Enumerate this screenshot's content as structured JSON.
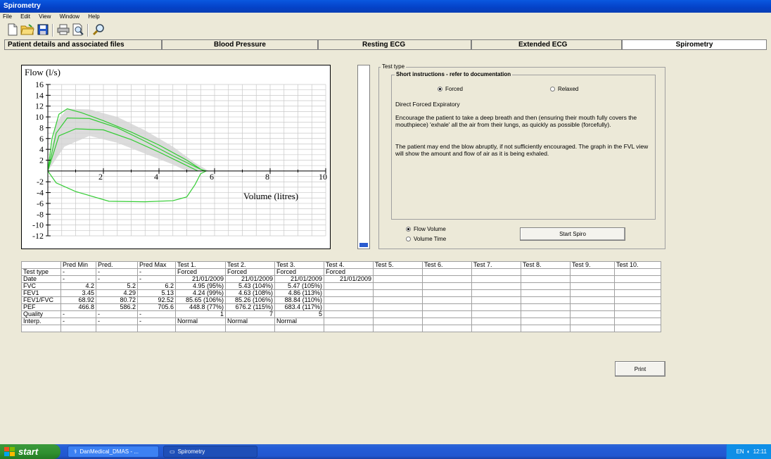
{
  "window": {
    "title": "Spirometry"
  },
  "menu": {
    "items": [
      "File",
      "Edit",
      "View",
      "Window",
      "Help"
    ]
  },
  "toolbar": {
    "icons": [
      "new-file-icon",
      "open-folder-icon",
      "save-icon",
      "print-icon",
      "print-preview-icon",
      "find-icon"
    ]
  },
  "tabs": [
    {
      "label": "Patient details and associated files",
      "active": false
    },
    {
      "label": "Blood Pressure",
      "active": false
    },
    {
      "label": "Resting ECG",
      "active": false
    },
    {
      "label": "Extended ECG",
      "active": false
    },
    {
      "label": "Spirometry",
      "active": true
    }
  ],
  "chart_data": {
    "type": "line",
    "ylabel": "Flow (l/s)",
    "xlabel": "Volume (litres)",
    "xlim": [
      0,
      10
    ],
    "ylim": [
      -12,
      16
    ],
    "xticks": [
      2,
      4,
      6,
      8,
      10
    ],
    "yticks": [
      16,
      14,
      12,
      10,
      8,
      6,
      4,
      2,
      -2,
      -4,
      -6,
      -8,
      -10,
      -12
    ],
    "grid": true,
    "colors": {
      "curves": "#33cc33",
      "band": "#d3d3d3"
    },
    "predicted_band": {
      "upper": [
        [
          0,
          0
        ],
        [
          0.3,
          9
        ],
        [
          0.7,
          11.5
        ],
        [
          1.5,
          11.4
        ],
        [
          2.5,
          10
        ],
        [
          3.5,
          7.5
        ],
        [
          4.5,
          4.5
        ],
        [
          5.3,
          1.5
        ],
        [
          5.8,
          0
        ]
      ],
      "lower": [
        [
          0,
          0
        ],
        [
          0.6,
          4.5
        ],
        [
          1.5,
          6.5
        ],
        [
          2.5,
          5.2
        ],
        [
          3.5,
          3.2
        ],
        [
          4.5,
          1.2
        ],
        [
          5.0,
          0
        ]
      ]
    },
    "series": [
      {
        "points": [
          [
            0,
            0
          ],
          [
            0.15,
            6
          ],
          [
            0.4,
            10.5
          ],
          [
            0.7,
            11.5
          ],
          [
            1.2,
            10.8
          ],
          [
            2,
            9.3
          ],
          [
            3,
            7.2
          ],
          [
            4,
            4.8
          ],
          [
            5,
            2
          ],
          [
            5.6,
            0
          ]
        ]
      },
      {
        "points": [
          [
            0,
            0
          ],
          [
            0.3,
            7
          ],
          [
            0.7,
            9.8
          ],
          [
            1.5,
            9.7
          ],
          [
            2.5,
            8
          ],
          [
            3.5,
            5.5
          ],
          [
            4.5,
            2.8
          ],
          [
            5.5,
            0.3
          ],
          [
            5.7,
            0
          ]
        ]
      },
      {
        "points": [
          [
            0,
            0
          ],
          [
            0.4,
            6.5
          ],
          [
            1,
            7.8
          ],
          [
            2,
            7.6
          ],
          [
            3,
            5.8
          ],
          [
            4,
            3.5
          ],
          [
            5,
            1
          ],
          [
            5.4,
            0
          ]
        ]
      },
      {
        "points": [
          [
            0,
            0
          ],
          [
            0.3,
            -2.2
          ],
          [
            1,
            -3.8
          ],
          [
            2.2,
            -5.6
          ],
          [
            3.5,
            -5.7
          ],
          [
            4.5,
            -5.5
          ],
          [
            5,
            -4.8
          ],
          [
            5.3,
            -2.5
          ],
          [
            5.5,
            -0.5
          ],
          [
            5.7,
            0
          ]
        ]
      }
    ]
  },
  "test_type": {
    "group_label": "Test type",
    "instructions_label": "Short instructions - refer to documentation",
    "radio_forced": "Forced",
    "radio_relaxed": "Relaxed",
    "selected": "Forced",
    "heading": "Direct Forced Expiratory",
    "para1": "Encourage the patient to take a deep breath and then (ensuring their mouth fully covers the mouthpiece) 'exhale' all the air from their lungs, as quickly as possible (forcefully).",
    "para2": "The patient may end the blow abruptly, if not sufficiently encouraged. The graph in the FVL view will show the amount and flow of air as it is being exhaled.",
    "view_flow_volume": "Flow Volume",
    "view_volume_time": "Volume Time",
    "view_selected": "Flow Volume",
    "start_button": "Start Spiro"
  },
  "results_table": {
    "headers": [
      "",
      "Pred Min",
      "Pred.",
      "Pred Max",
      "Test 1.",
      "Test 2.",
      "Test 3.",
      "Test 4.",
      "Test 5.",
      "Test 6.",
      "Test 7.",
      "Test 8.",
      "Test 9.",
      "Test 10."
    ],
    "rows": [
      [
        "Test type",
        "-",
        "-",
        "-",
        "Forced",
        "Forced",
        "Forced",
        "Forced",
        "",
        "",
        "",
        "",
        "",
        ""
      ],
      [
        "Date",
        "-",
        "-",
        "-",
        "21/01/2009",
        "21/01/2009",
        "21/01/2009",
        "21/01/2009",
        "",
        "",
        "",
        "",
        "",
        ""
      ],
      [
        "FVC",
        "4.2",
        "5.2",
        "6.2",
        "4.95 (95%)",
        "5.43 (104%)",
        "5.47 (105%)",
        "",
        "",
        "",
        "",
        "",
        "",
        ""
      ],
      [
        "FEV1",
        "3.45",
        "4.29",
        "5.13",
        "4.24 (99%)",
        "4.63 (108%)",
        "4.86 (113%)",
        "",
        "",
        "",
        "",
        "",
        "",
        ""
      ],
      [
        "FEV1/FVC",
        "68.92",
        "80.72",
        "92.52",
        "85.65 (106%)",
        "85.26 (106%)",
        "88.84 (110%)",
        "",
        "",
        "",
        "",
        "",
        "",
        ""
      ],
      [
        "PEF",
        "466.8",
        "586.2",
        "705.6",
        "448.8 (77%)",
        "676.2 (115%)",
        "683.4 (117%)",
        "",
        "",
        "",
        "",
        "",
        "",
        ""
      ],
      [
        "Quality",
        "-",
        "-",
        "-",
        "1",
        "7",
        "5",
        "",
        "",
        "",
        "",
        "",
        "",
        ""
      ],
      [
        "Interp.",
        "-",
        "-",
        "-",
        "Normal",
        "Normal",
        "Normal",
        "",
        "",
        "",
        "",
        "",
        "",
        ""
      ],
      [
        "",
        "",
        "",
        "",
        "",
        "",
        "",
        "",
        "",
        "",
        "",
        "",
        "",
        ""
      ]
    ]
  },
  "print_button": "Print",
  "taskbar": {
    "start_label": "start",
    "tasks": [
      {
        "label": "DanMedical_DMAS - ...",
        "active": false
      },
      {
        "label": "Spirometry",
        "active": true
      }
    ],
    "language": "EN",
    "clock": "12:11"
  }
}
